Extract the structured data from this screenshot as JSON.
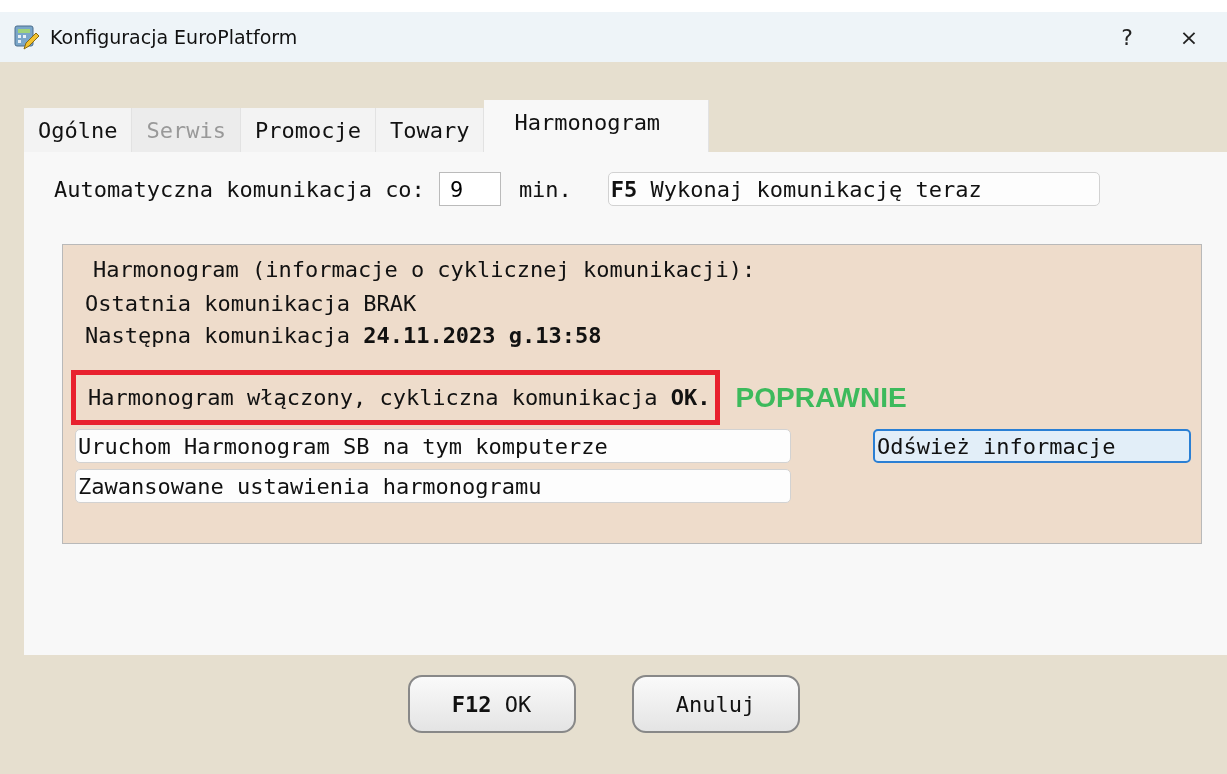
{
  "window": {
    "title": "Konfiguracja EuroPlatform",
    "help": "?",
    "close": "×"
  },
  "tabs": [
    {
      "label": "Ogólne",
      "selected": false,
      "disabled": false
    },
    {
      "label": "Serwis",
      "selected": false,
      "disabled": true
    },
    {
      "label": "Promocje",
      "selected": false,
      "disabled": false
    },
    {
      "label": "Towary",
      "selected": false,
      "disabled": false
    },
    {
      "label": "Harmonogram",
      "selected": true,
      "disabled": false
    }
  ],
  "interval": {
    "label": "Automatyczna komunikacja co:",
    "value": "9",
    "unit": "min.",
    "button": "**F5** Wykonaj komunikację teraz"
  },
  "schedule": {
    "title": "Harmonogram (informacje o cyklicznej komunikacji):",
    "lines": [
      "Ostatnia komunikacja BRAK",
      "Następna komunikacja **24.11.2023 g.13:58**"
    ],
    "status": {
      "text": "Harmonogram włączony, cykliczna komunikacja **OK.**",
      "highlighted": true
    },
    "annotation": {
      "text": "POPRAWNIE",
      "color": "#3dba5c"
    },
    "buttons": [
      {
        "label": "Uruchom Harmonogram SB na tym komputerze",
        "focused": false
      },
      {
        "label": "Zawansowane ustawienia harmonogramu",
        "focused": false
      }
    ],
    "refresh": {
      "label": "Odśwież informacje",
      "focused": true
    }
  },
  "footer": [
    "**F12** OK",
    "Anuluj"
  ]
}
